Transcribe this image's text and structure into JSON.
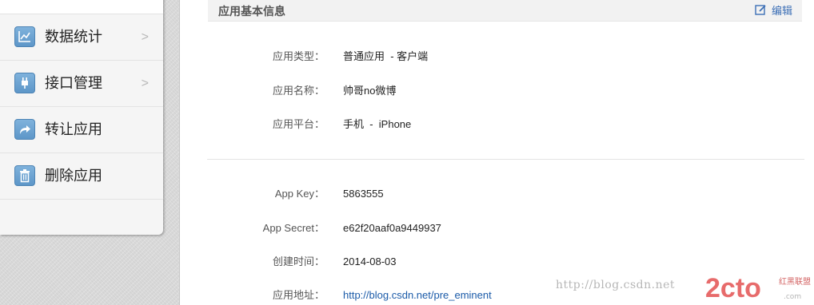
{
  "sidebar": {
    "items": [
      {
        "label": "数据统计",
        "icon": "chart-icon",
        "has_chevron": true
      },
      {
        "label": "接口管理",
        "icon": "plug-icon",
        "has_chevron": true
      },
      {
        "label": "转让应用",
        "icon": "share-icon",
        "has_chevron": false
      },
      {
        "label": "删除应用",
        "icon": "trash-icon",
        "has_chevron": false
      }
    ],
    "chevron": ">"
  },
  "section": {
    "title": "应用基本信息",
    "edit_label": "编辑"
  },
  "info_basic": [
    {
      "label": "应用类型：",
      "value": "普通应用  - 客户端"
    },
    {
      "label": "应用名称：",
      "value": "帅哥no微博"
    },
    {
      "label": "应用平台：",
      "value": "手机  -  iPhone"
    }
  ],
  "info_keys": [
    {
      "label": "App Key：",
      "value": "5863555"
    },
    {
      "label": "App Secret：",
      "value": "e62f20aaf0a9449937"
    },
    {
      "label": "创建时间：",
      "value": "2014-08-03"
    },
    {
      "label": "应用地址：",
      "value": "http://blog.csdn.net/pre_eminent"
    }
  ],
  "watermark": {
    "url": "http://blog.csdn.net",
    "logo": "2cto",
    "logo_tag": "红黑联盟",
    "logo_sub": ".com"
  },
  "colors": {
    "accent": "#3c6fb6",
    "icon_bg": "#6aa0d0",
    "link": "#1a5aa8"
  }
}
